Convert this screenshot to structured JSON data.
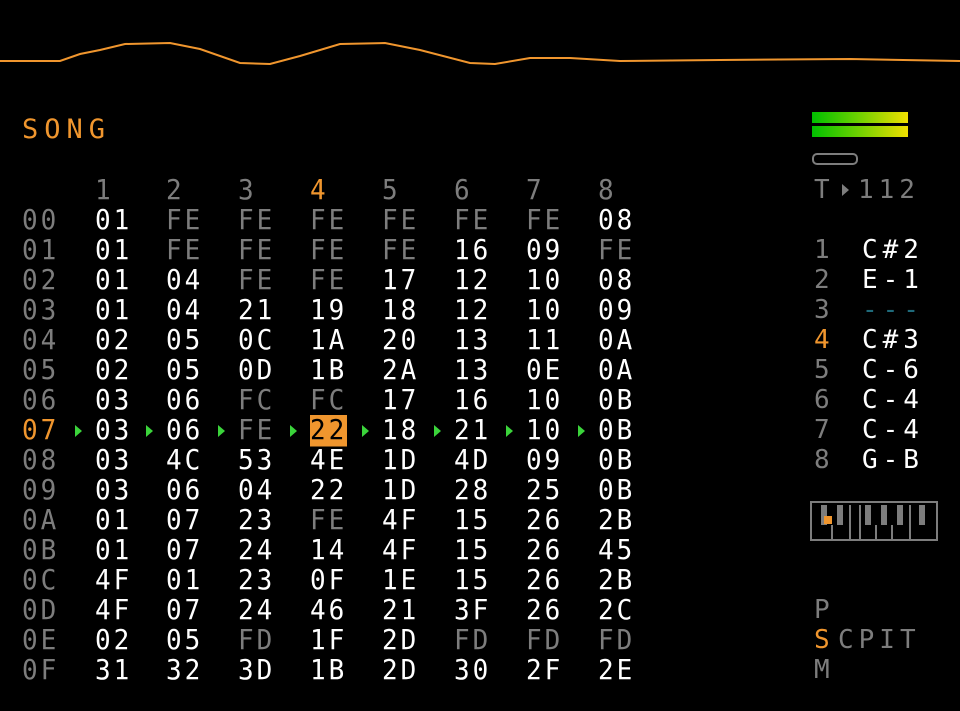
{
  "screen": {
    "title": "SONG",
    "colors": {
      "accent": "#f0962e",
      "text": "#ffffff",
      "dim": "#7d7d7d",
      "cursor_arrow": "#3bd43b",
      "empty_note": "#1f6a7a"
    }
  },
  "song": {
    "track_headers": [
      "1",
      "2",
      "3",
      "4",
      "5",
      "6",
      "7",
      "8"
    ],
    "current_track_index": 3,
    "current_row_index": 7,
    "rows": [
      {
        "label": "00",
        "cells": [
          "01",
          "FE",
          "FE",
          "FE",
          "FE",
          "FE",
          "FE",
          "08"
        ]
      },
      {
        "label": "01",
        "cells": [
          "01",
          "FE",
          "FE",
          "FE",
          "FE",
          "16",
          "09",
          "FE"
        ]
      },
      {
        "label": "02",
        "cells": [
          "01",
          "04",
          "FE",
          "FE",
          "17",
          "12",
          "10",
          "08"
        ]
      },
      {
        "label": "03",
        "cells": [
          "01",
          "04",
          "21",
          "19",
          "18",
          "12",
          "10",
          "09"
        ]
      },
      {
        "label": "04",
        "cells": [
          "02",
          "05",
          "0C",
          "1A",
          "20",
          "13",
          "11",
          "0A"
        ]
      },
      {
        "label": "05",
        "cells": [
          "02",
          "05",
          "0D",
          "1B",
          "2A",
          "13",
          "0E",
          "0A"
        ]
      },
      {
        "label": "06",
        "cells": [
          "03",
          "06",
          "FC",
          "FC",
          "17",
          "16",
          "10",
          "0B"
        ]
      },
      {
        "label": "07",
        "cells": [
          "03",
          "06",
          "FE",
          "22",
          "18",
          "21",
          "10",
          "0B"
        ]
      },
      {
        "label": "08",
        "cells": [
          "03",
          "4C",
          "53",
          "4E",
          "1D",
          "4D",
          "09",
          "0B"
        ]
      },
      {
        "label": "09",
        "cells": [
          "03",
          "06",
          "04",
          "22",
          "1D",
          "28",
          "25",
          "0B"
        ]
      },
      {
        "label": "0A",
        "cells": [
          "01",
          "07",
          "23",
          "FE",
          "4F",
          "15",
          "26",
          "2B"
        ]
      },
      {
        "label": "0B",
        "cells": [
          "01",
          "07",
          "24",
          "14",
          "4F",
          "15",
          "26",
          "45"
        ]
      },
      {
        "label": "0C",
        "cells": [
          "4F",
          "01",
          "23",
          "0F",
          "1E",
          "15",
          "26",
          "2B"
        ]
      },
      {
        "label": "0D",
        "cells": [
          "4F",
          "07",
          "24",
          "46",
          "21",
          "3F",
          "26",
          "2C"
        ]
      },
      {
        "label": "0E",
        "cells": [
          "02",
          "05",
          "FD",
          "1F",
          "2D",
          "FD",
          "FD",
          "FD"
        ]
      },
      {
        "label": "0F",
        "cells": [
          "31",
          "32",
          "3D",
          "1B",
          "2D",
          "30",
          "2F",
          "2E"
        ]
      }
    ]
  },
  "sidebar": {
    "tempo_prefix": "T",
    "tempo_value": "112",
    "tracks": [
      {
        "num": "1",
        "note": "C#2"
      },
      {
        "num": "2",
        "note": "E-1"
      },
      {
        "num": "3",
        "note": "---"
      },
      {
        "num": "4",
        "note": "C#3"
      },
      {
        "num": "5",
        "note": "C-6"
      },
      {
        "num": "6",
        "note": "C-4"
      },
      {
        "num": "7",
        "note": "C-4"
      },
      {
        "num": "8",
        "note": "G-B"
      }
    ],
    "nav_top": "P",
    "nav_current": "S",
    "nav_row_rest": "CPIT",
    "nav_bottom": "M"
  }
}
